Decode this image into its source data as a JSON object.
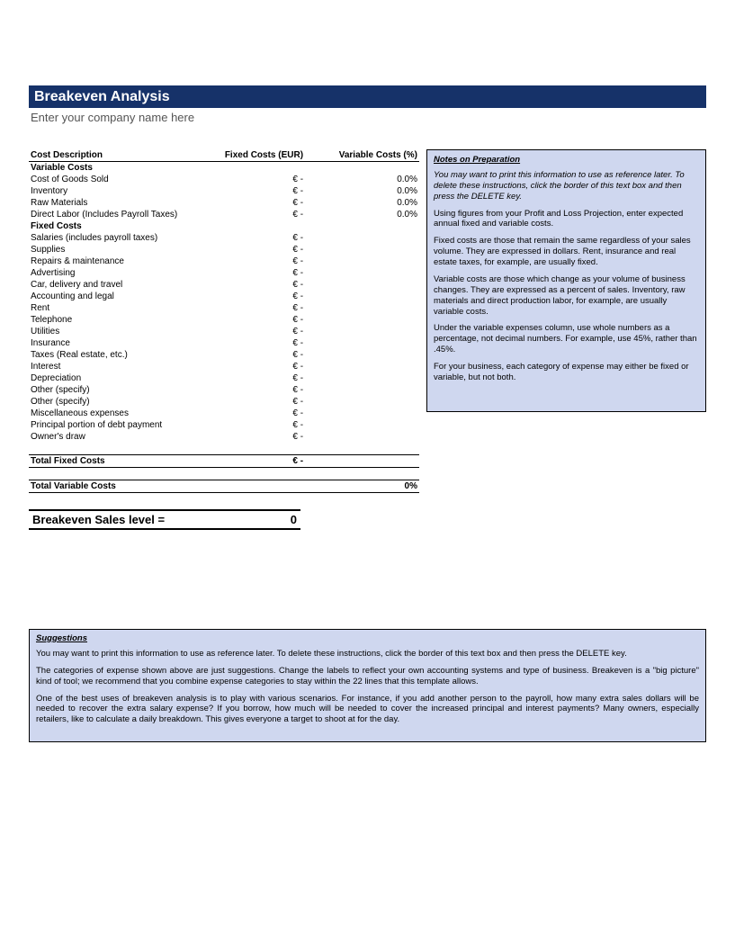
{
  "header": {
    "title": "Breakeven Analysis",
    "subtitle": "Enter your company name here"
  },
  "columns": {
    "desc": "Cost Description",
    "fixed": "Fixed Costs (EUR)",
    "var": "Variable Costs (%)"
  },
  "variable_section": {
    "label": "Variable Costs",
    "rows": [
      {
        "desc": "Cost of Goods Sold",
        "fixed": "€ -",
        "var": "0.0%"
      },
      {
        "desc": "Inventory",
        "fixed": "€ -",
        "var": "0.0%"
      },
      {
        "desc": "Raw Materials",
        "fixed": "€ -",
        "var": "0.0%"
      },
      {
        "desc": "Direct Labor (Includes Payroll Taxes)",
        "fixed": "€ -",
        "var": "0.0%"
      }
    ]
  },
  "fixed_section": {
    "label": "Fixed Costs",
    "rows": [
      {
        "desc": "Salaries (includes payroll taxes)",
        "fixed": "€ -"
      },
      {
        "desc": "Supplies",
        "fixed": "€ -"
      },
      {
        "desc": "Repairs & maintenance",
        "fixed": "€ -"
      },
      {
        "desc": "Advertising",
        "fixed": "€ -"
      },
      {
        "desc": "Car, delivery and travel",
        "fixed": "€ -"
      },
      {
        "desc": "Accounting and legal",
        "fixed": "€ -"
      },
      {
        "desc": "Rent",
        "fixed": "€ -"
      },
      {
        "desc": "Telephone",
        "fixed": "€ -"
      },
      {
        "desc": "Utilities",
        "fixed": "€ -"
      },
      {
        "desc": "Insurance",
        "fixed": "€ -"
      },
      {
        "desc": "Taxes (Real estate, etc.)",
        "fixed": "€ -"
      },
      {
        "desc": "Interest",
        "fixed": "€ -"
      },
      {
        "desc": "Depreciation",
        "fixed": "€ -"
      },
      {
        "desc": "Other (specify)",
        "fixed": "€ -"
      },
      {
        "desc": "Other (specify)",
        "fixed": "€ -"
      },
      {
        "desc": "Miscellaneous expenses",
        "fixed": "€ -"
      },
      {
        "desc": "Principal portion of debt payment",
        "fixed": "€ -"
      },
      {
        "desc": "Owner's draw",
        "fixed": "€ -"
      }
    ]
  },
  "totals": {
    "fixed_label": "Total Fixed Costs",
    "fixed_value": "€ -",
    "var_label": "Total Variable Costs",
    "var_value": "0%"
  },
  "breakeven": {
    "label": "Breakeven Sales level  =",
    "value": "0"
  },
  "notes": {
    "title": "Notes on Preparation",
    "p1": "You may want to print this information to use as reference later. To delete these instructions, click the border of this text box and then press the DELETE key.",
    "p2": "Using figures from your Profit and Loss Projection, enter expected annual fixed and variable costs.",
    "p3": "Fixed costs are those that remain the same regardless of your sales volume. They are expressed in dollars. Rent, insurance and real estate taxes, for example, are usually fixed.",
    "p4": "Variable costs are those which change as your volume of business changes. They are expressed as a percent of sales. Inventory, raw materials and direct production labor, for example, are usually variable costs.",
    "p5": "Under the variable expenses column, use whole numbers as a percentage, not decimal numbers. For example, use 45%, rather than .45%.",
    "p6": "For your business, each category of expense may either be fixed or variable, but not both."
  },
  "suggestions": {
    "title": "Suggestions",
    "p1": "You may want to print this information to use as reference later. To delete these instructions, click the border of this text box and then press the DELETE key.",
    "p2": "The categories of expense shown above are just suggestions. Change the labels to reflect your own accounting systems and type of business. Breakeven is a \"big picture\" kind of tool; we recommend that you combine expense categories to stay within the 22 lines that this template allows.",
    "p3": "One of the best uses of breakeven analysis is to play with various scenarios. For instance, if you add another person to the payroll, how many extra sales dollars will be needed to recover the extra salary expense? If you borrow, how much will be needed to cover the increased principal and interest payments? Many owners, especially retailers, like to calculate a daily breakdown. This gives everyone a target to shoot at for the day."
  }
}
